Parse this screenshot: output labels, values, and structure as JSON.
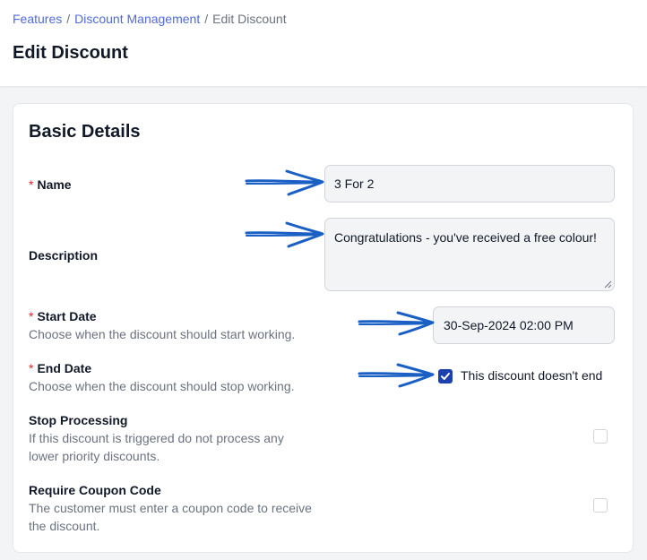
{
  "breadcrumb": {
    "items": [
      "Features",
      "Discount Management"
    ],
    "current": "Edit Discount",
    "separator": "/"
  },
  "page_title": "Edit Discount",
  "section_title": "Basic Details",
  "fields": {
    "name": {
      "label": "Name",
      "required": "*",
      "value": "3 For 2"
    },
    "description": {
      "label": "Description",
      "value": "Congratulations - you've received a free colour!"
    },
    "start_date": {
      "label": "Start Date",
      "required": "*",
      "help": "Choose when the discount should start working.",
      "value": "30-Sep-2024 02:00 PM"
    },
    "end_date": {
      "label": "End Date",
      "required": "*",
      "help": "Choose when the discount should stop working.",
      "checkbox_label": "This discount doesn't end",
      "checked": true
    },
    "stop_processing": {
      "label": "Stop Processing",
      "help": "If this discount is triggered do not process any lower priority discounts.",
      "checked": false
    },
    "require_coupon": {
      "label": "Require Coupon Code",
      "help": "The customer must enter a coupon code to receive the discount.",
      "checked": false
    }
  },
  "colors": {
    "link": "#4f6bd8",
    "required": "#dc2626",
    "checkbox_checked": "#1e40af",
    "annotation_arrow": "#1a5fc4"
  },
  "annotations": {
    "arrow_icon": "hand-drawn-arrow-icon",
    "count": 4
  }
}
